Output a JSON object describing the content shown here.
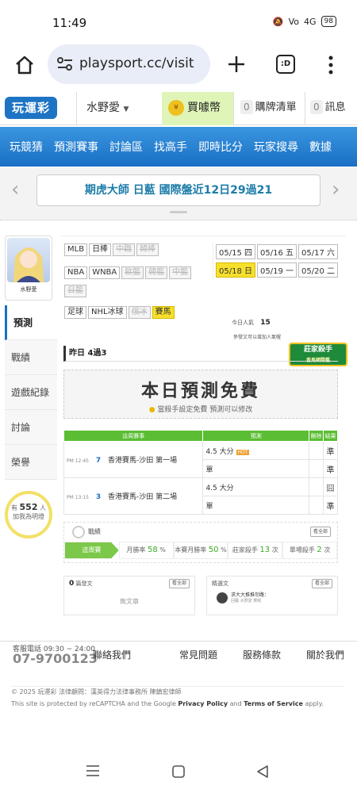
{
  "status": {
    "time": "11:49",
    "battery": "98",
    "signal": "4G"
  },
  "browser": {
    "url": "playsport.cc/visit",
    "tab_count": ":D"
  },
  "header": {
    "logo": "玩運彩",
    "user": "水野愛",
    "coin_label": "買噱幣",
    "cart_count": "0",
    "cart_label": "購牌清單",
    "msg_count": "0",
    "msg_label": "訊息"
  },
  "nav": [
    "玩競猜",
    "預測賽事",
    "討論區",
    "找高手",
    "即時比分",
    "玩家搜尋",
    "數據"
  ],
  "banner": {
    "text": "期虎大師 日藍 國際盤近12日29過21"
  },
  "sidebar": {
    "username": "水野愛",
    "menu": [
      "預測",
      "戰績",
      "遊戲紀錄",
      "討論",
      "榮譽"
    ],
    "fans_prefix": "有",
    "fans_count": "552",
    "fans_suffix": "人",
    "fans_note": "加我為明燈"
  },
  "leagues": {
    "row1": [
      "MLB",
      "日棒",
      "中職",
      "韓棒"
    ],
    "row2": [
      "NBA",
      "WNBA",
      "歐籃",
      "韓籃",
      "中籃"
    ],
    "row3": [
      "日籃"
    ],
    "row4": [
      "足球",
      "NHL冰球",
      "俄冰",
      "賽馬"
    ]
  },
  "dates": [
    "05/15 四",
    "05/16 五",
    "05/17 六",
    "05/18 日",
    "05/19 一",
    "05/20 二"
  ],
  "visitors": {
    "label": "今日人氣",
    "count": "15",
    "note": "參發文可以增加人氣喔"
  },
  "badge": {
    "text": "莊家殺手",
    "sub": "香馬國際盤"
  },
  "yesterday": "昨日 4過3",
  "promo": {
    "title": "本日預測免費",
    "sub": "當殺手設定免費 預測可以修改"
  },
  "table": {
    "headers": [
      "這周賽事",
      "預測",
      "刪除",
      "結果"
    ],
    "rows": [
      {
        "time": "PM 12:45",
        "num": "7",
        "match": "香港賽馬-沙田 第一場",
        "pred1": "4.5 大分",
        "pred2": "單",
        "res1": "準",
        "res2": "準"
      },
      {
        "time": "PM 13:15",
        "num": "3",
        "match": "香港賽馬-沙田 第二場",
        "pred1": "4.5 大分",
        "pred2": "單",
        "res1": "囧",
        "res2": "準"
      }
    ]
  },
  "record": {
    "title": "戰績",
    "view_all": "看全部",
    "week": "這周賽",
    "stats": [
      {
        "label": "月勝率",
        "value": "58",
        "unit": "%"
      },
      {
        "label": "本賽月勝率",
        "value": "50",
        "unit": "%"
      },
      {
        "label": "莊家殺手",
        "value": "13",
        "unit": "次"
      },
      {
        "label": "單場殺手",
        "value": "2",
        "unit": "次"
      }
    ]
  },
  "articles": {
    "count": "0",
    "label": "篇發文",
    "view_all": "看全部",
    "empty": "無文章",
    "reply_label": "精選文",
    "reply_view_all": "看全部",
    "reply_title": "求大大推推勿路：",
    "reply_sub": "回覆 水野愛 算賊"
  },
  "footer": {
    "phone_label": "客服電話 09:30 ~ 24:00",
    "phone": "07-9700123",
    "links": [
      "聯絡我們",
      "常見問題",
      "服務條款",
      "關於我們"
    ],
    "copyright": "© 2025 玩運彩 法律顧問：漢英得力法律事務所 陳鎮宏律師",
    "recaptcha_prefix": "This site is protected by reCAPTCHA and the Google",
    "privacy": "Privacy Policy",
    "and": "and",
    "terms": "Terms of Service",
    "apply": "apply."
  }
}
